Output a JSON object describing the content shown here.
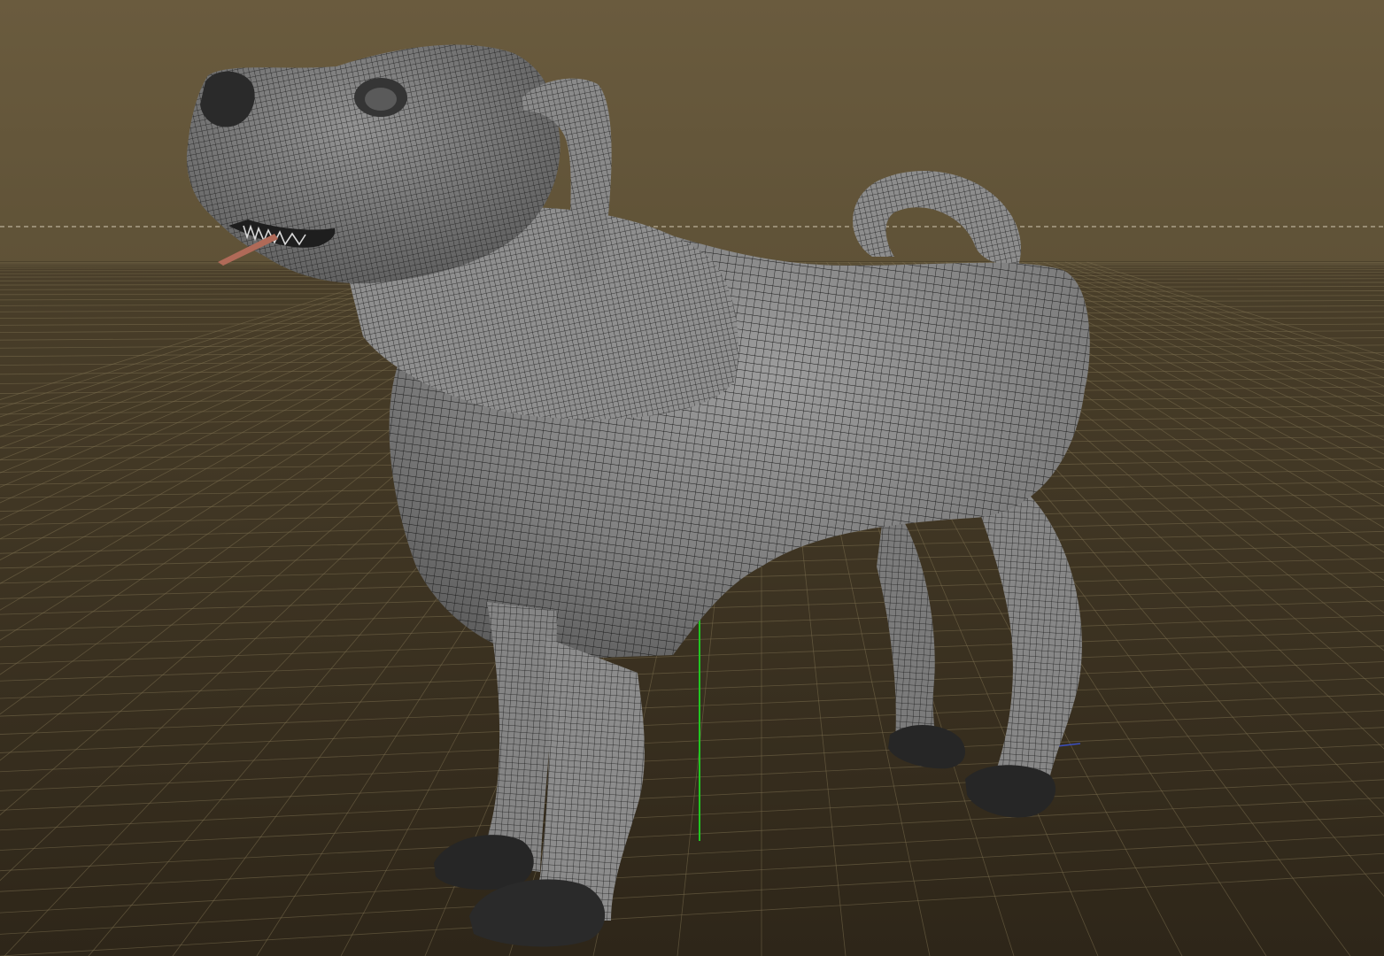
{
  "viewport": {
    "shading_mode": "wireframe-on-shaded",
    "background_color": "#685a3e",
    "floor_color": "#332a1c",
    "grid_line_color": "#7d7050",
    "horizon_line_color": "#cfc7b2",
    "mesh_color": "#8a8a8a",
    "wire_color": "#1c1c1c",
    "paw_color": "#262626",
    "tongue_color": "#b06a58",
    "axis_y_color": "#22c522",
    "axis_x_color": "#3a4fc0"
  },
  "object": {
    "type": "dog-mesh"
  }
}
